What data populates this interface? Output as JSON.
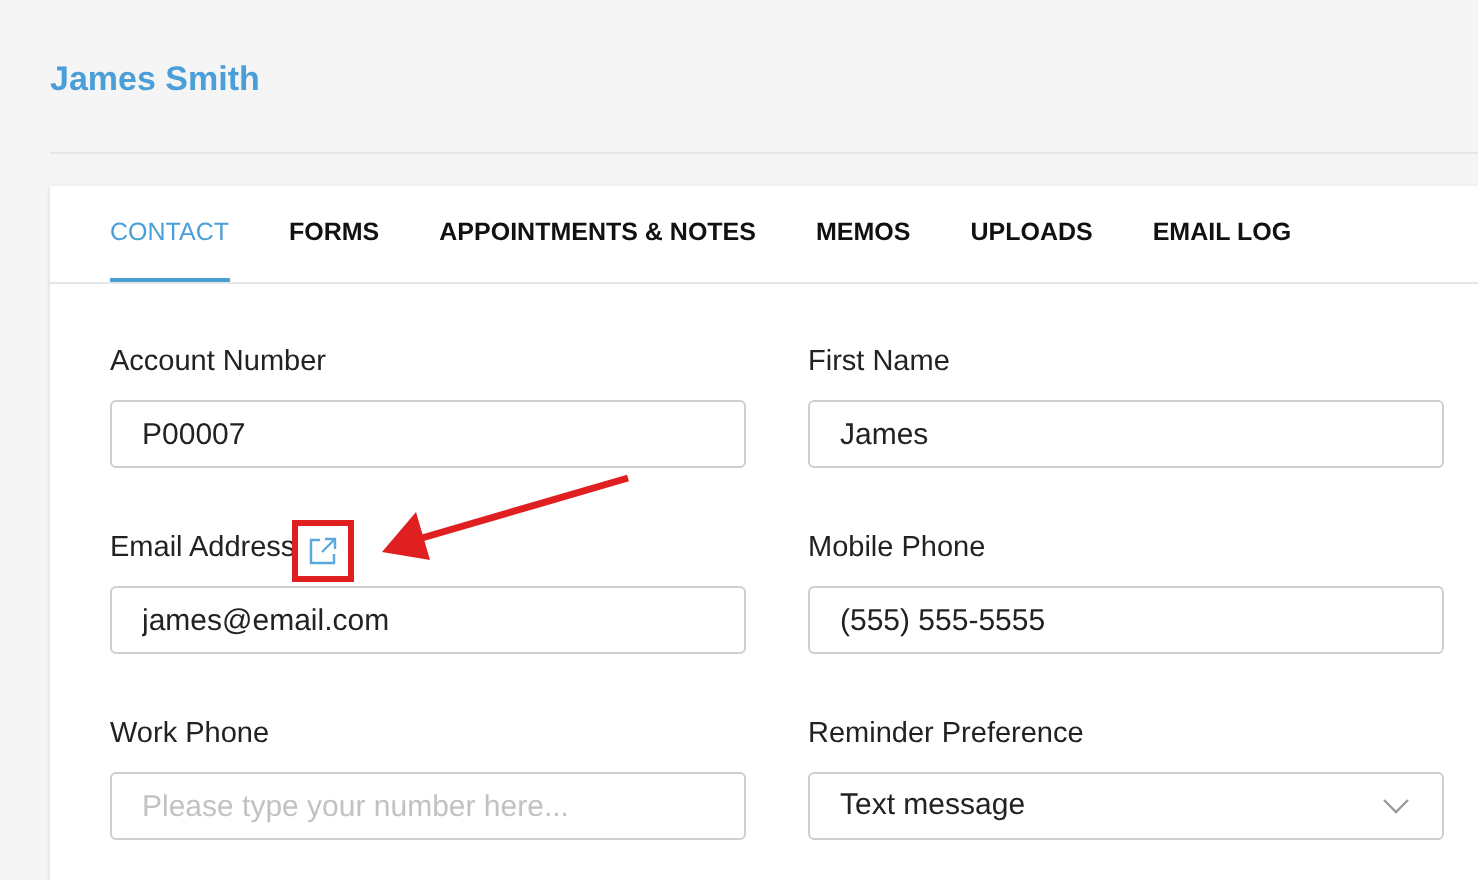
{
  "page": {
    "title": "James Smith"
  },
  "tabs": [
    {
      "label": "CONTACT",
      "selected": true
    },
    {
      "label": "FORMS",
      "selected": false
    },
    {
      "label": "APPOINTMENTS & NOTES",
      "selected": false
    },
    {
      "label": "MEMOS",
      "selected": false
    },
    {
      "label": "UPLOADS",
      "selected": false
    },
    {
      "label": "EMAIL LOG",
      "selected": false
    }
  ],
  "fields": [
    {
      "kind": "text",
      "label": "Account Number",
      "value": "P00007"
    },
    {
      "kind": "text",
      "label": "First Name",
      "value": "James"
    },
    {
      "kind": "email",
      "label": "Email Address",
      "value": "james@email.com"
    },
    {
      "kind": "text",
      "label": "Mobile Phone",
      "value": "(555) 555-5555"
    },
    {
      "kind": "text",
      "label": "Work Phone",
      "placeholder": "Please type your number here..."
    },
    {
      "kind": "select",
      "label": "Reminder Preference",
      "value": "Text message"
    }
  ]
}
